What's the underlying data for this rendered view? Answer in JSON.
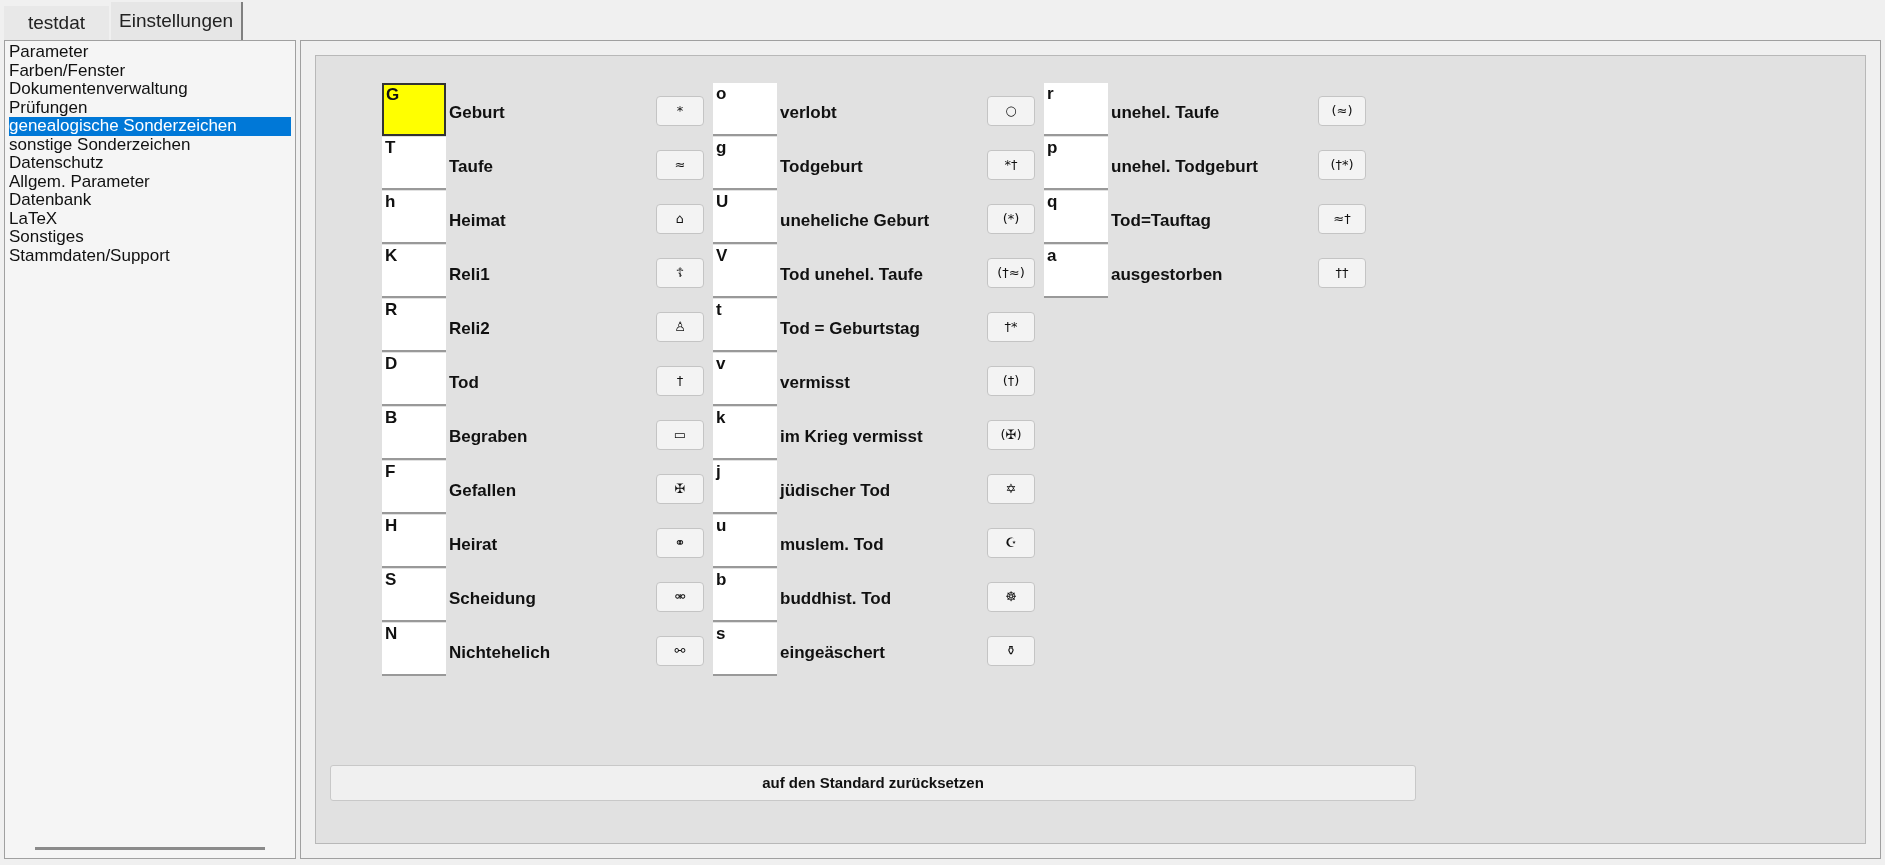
{
  "tabs": [
    {
      "label": "testdat",
      "selected": false
    },
    {
      "label": "Einstellungen",
      "selected": true
    }
  ],
  "sidebar": {
    "items": [
      {
        "label": "Parameter",
        "selected": false
      },
      {
        "label": "Farben/Fenster",
        "selected": false
      },
      {
        "label": "Dokumentenverwaltung",
        "selected": false
      },
      {
        "label": "Prüfungen",
        "selected": false
      },
      {
        "label": "genealogische Sonderzeichen",
        "selected": true
      },
      {
        "label": "sonstige Sonderzeichen",
        "selected": false
      },
      {
        "label": "Datenschutz",
        "selected": false
      },
      {
        "label": "Allgem. Parameter",
        "selected": false
      },
      {
        "label": "Datenbank",
        "selected": false
      },
      {
        "label": "LaTeX",
        "selected": false
      },
      {
        "label": "Sonstiges",
        "selected": false
      },
      {
        "label": "Stammdaten/Support",
        "selected": false
      }
    ]
  },
  "columns": [
    {
      "rows": [
        {
          "key": "G",
          "label": "Geburt",
          "symbol": "*",
          "selected": true
        },
        {
          "key": "T",
          "label": "Taufe",
          "symbol": "≈",
          "selected": false
        },
        {
          "key": "h",
          "label": "Heimat",
          "symbol": "⌂",
          "selected": false
        },
        {
          "key": "K",
          "label": "Reli1",
          "symbol": "☦",
          "selected": false
        },
        {
          "key": "R",
          "label": "Reli2",
          "symbol": "♙",
          "selected": false
        },
        {
          "key": "D",
          "label": "Tod",
          "symbol": "†",
          "selected": false
        },
        {
          "key": "B",
          "label": "Begraben",
          "symbol": "▭",
          "selected": false
        },
        {
          "key": "F",
          "label": "Gefallen",
          "symbol": "✠",
          "selected": false
        },
        {
          "key": "H",
          "label": "Heirat",
          "symbol": "⚭",
          "selected": false
        },
        {
          "key": "S",
          "label": "Scheidung",
          "symbol": "⚮",
          "selected": false
        },
        {
          "key": "N",
          "label": "Nichtehelich",
          "symbol": "⚯",
          "selected": false
        }
      ]
    },
    {
      "rows": [
        {
          "key": "o",
          "label": "verlobt",
          "symbol": "○",
          "selected": false
        },
        {
          "key": "g",
          "label": "Todgeburt",
          "symbol": "*†",
          "selected": false
        },
        {
          "key": "U",
          "label": "uneheliche Geburt",
          "symbol": "(*)",
          "selected": false
        },
        {
          "key": "V",
          "label": "Tod unehel. Taufe",
          "symbol": "(†≈)",
          "selected": false
        },
        {
          "key": "t",
          "label": "Tod = Geburtstag",
          "symbol": "†*",
          "selected": false
        },
        {
          "key": "v",
          "label": "vermisst",
          "symbol": "(†)",
          "selected": false
        },
        {
          "key": "k",
          "label": "im Krieg vermisst",
          "symbol": "(✠)",
          "selected": false
        },
        {
          "key": "j",
          "label": "jüdischer Tod",
          "symbol": "✡",
          "selected": false
        },
        {
          "key": "u",
          "label": "muslem. Tod",
          "symbol": "☪",
          "selected": false
        },
        {
          "key": "b",
          "label": "buddhist. Tod",
          "symbol": "☸",
          "selected": false
        },
        {
          "key": "s",
          "label": "eingeäschert",
          "symbol": "⚱",
          "selected": false
        }
      ]
    },
    {
      "rows": [
        {
          "key": "r",
          "label": "unehel. Taufe",
          "symbol": "(≈)",
          "selected": false
        },
        {
          "key": "p",
          "label": "unehel. Todgeburt",
          "symbol": "(†*)",
          "selected": false
        },
        {
          "key": "q",
          "label": "Tod=Tauftag",
          "symbol": "≈†",
          "selected": false
        },
        {
          "key": "a",
          "label": "ausgestorben",
          "symbol": "††",
          "selected": false
        }
      ]
    }
  ],
  "reset_button": "auf den Standard zurücksetzen"
}
